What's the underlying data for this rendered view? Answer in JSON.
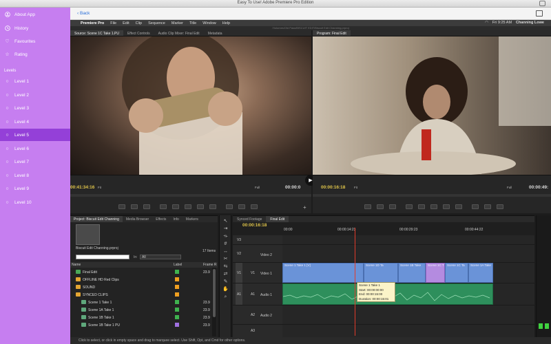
{
  "window": {
    "title": "Easy To Use! Adobe Premiere Pro Edition"
  },
  "sidebar": {
    "items": [
      {
        "label": "About App",
        "icon": "person-icon"
      },
      {
        "label": "History",
        "icon": "clock-icon"
      },
      {
        "label": "Favourites",
        "icon": "heart-icon"
      },
      {
        "label": "Rating",
        "icon": "star-icon"
      }
    ],
    "levels_heading": "Levels",
    "levels": [
      "Level 1",
      "Level 2",
      "Level 3",
      "Level 4",
      "Level 5",
      "Level 6",
      "Level 7",
      "Level 8",
      "Level 9",
      "Level 10"
    ],
    "active_level": "Level 5"
  },
  "topbar": {
    "back_label": "Back"
  },
  "menubar": {
    "items": [
      "Premiere Pro",
      "File",
      "Edit",
      "Clip",
      "Sequence",
      "Marker",
      "Title",
      "Window",
      "Help"
    ],
    "clock": "Fri 9:25 AM",
    "user": "Channing Lowe"
  },
  "pathbar": {
    "path": "/Volumes/Old Pass/BISCUIT EDIT/Biscuit Edit Channing.prproj"
  },
  "source_monitor": {
    "tabs": [
      "Source: Scene 1C Take 1.PU",
      "Effect Controls",
      "Audio Clip Mixer: Final Edit",
      "Metadata"
    ],
    "timecode": "00:41:34:16",
    "fit": "Fit",
    "full": "Full",
    "duration": "00:00:0"
  },
  "program_monitor": {
    "tabs": [
      "Program: Final Edit"
    ],
    "timecode": "00:00:16:18",
    "fit": "Fit",
    "full": "Full",
    "duration": "00:00:49:"
  },
  "project": {
    "tabs": [
      "Project: Biscuit Edit Channing",
      "Media Browser",
      "Effects",
      "Info",
      "Markers"
    ],
    "file": "Biscuit Edit Channing.prproj",
    "items_count": "17 Items",
    "in_label": "In:",
    "in_value": "All",
    "columns": [
      "Name",
      "Label",
      "Frame R"
    ],
    "rows": [
      {
        "name": "Final Edit",
        "label_color": "#3fb34f",
        "frame": "23.9",
        "indent": 1,
        "type": "sequence"
      },
      {
        "name": "OFFLINE HD Red Clips",
        "label_color": "#f0a020",
        "frame": "",
        "indent": 1,
        "type": "folder"
      },
      {
        "name": "SOUND",
        "label_color": "#f0a020",
        "frame": "",
        "indent": 1,
        "type": "folder"
      },
      {
        "name": "SYNCED CLIPS",
        "label_color": "#f0a020",
        "frame": "",
        "indent": 1,
        "type": "folder"
      },
      {
        "name": "Scene 1 Take 1",
        "label_color": "#3fb34f",
        "frame": "23.9",
        "indent": 2,
        "type": "clip"
      },
      {
        "name": "Scene 1A Take 1",
        "label_color": "#3fb34f",
        "frame": "23.9",
        "indent": 2,
        "type": "clip"
      },
      {
        "name": "Scene 1B Take 1",
        "label_color": "#3fb34f",
        "frame": "23.9",
        "indent": 2,
        "type": "clip"
      },
      {
        "name": "Scene 1B Take 1 PU",
        "label_color": "#a070e0",
        "frame": "23.9",
        "indent": 2,
        "type": "clip"
      }
    ]
  },
  "timeline": {
    "tabs": [
      "Synced Footage",
      "Final Edit"
    ],
    "timecode": "00:00:16:18",
    "ruler": [
      "00:00",
      "00:00:14:23",
      "00:00:29:23",
      "00:00:44:22"
    ],
    "tracks": [
      {
        "id": "V3",
        "name": ""
      },
      {
        "id": "V2",
        "name": "Video 2"
      },
      {
        "id": "V1",
        "name": "Video 1"
      },
      {
        "id": "A1",
        "name": "Audio 1"
      },
      {
        "id": "A2",
        "name": "Audio 2"
      },
      {
        "id": "A3",
        "name": ""
      }
    ],
    "source_patch": [
      "V1",
      "A1"
    ],
    "video_clips": [
      "Scene 1 Take 1 [V]",
      "Scene 1D Ta",
      "Scene 1B Take",
      "Scene 1C T",
      "Scene 1C Ta",
      "Scene 1A Take"
    ],
    "tooltip": [
      "Scene 1 Take 1",
      "Start: 00:00:00:00",
      "End: 00:00:15:00",
      "Duration: 00:00:15:01"
    ]
  },
  "status": {
    "text": "Click to select, or click in empty space and drag to marquee select. Use Shift, Opt, and Cmd for other options."
  },
  "colors": {
    "sidebar": "#c67ef0",
    "sidebar_active": "#9440d8",
    "video_clip": "#6a93d8",
    "audio_clip": "#2e8f5c",
    "playhead": "#e23a2a",
    "timecode": "#e0c54a"
  }
}
